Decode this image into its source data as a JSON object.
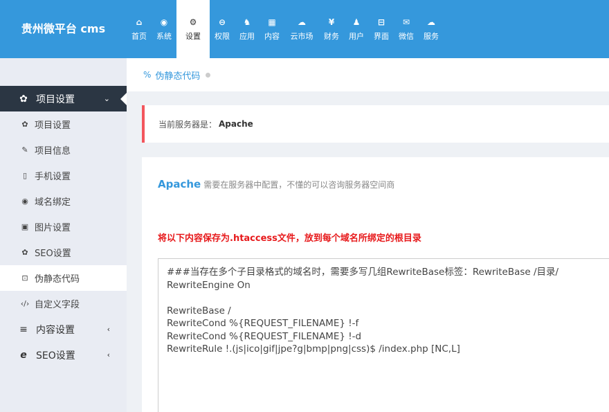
{
  "brand": "贵州微平台 cms",
  "nav": [
    {
      "label": "首页",
      "icon": "home-icon",
      "glyph": "⌂"
    },
    {
      "label": "系统",
      "icon": "globe-icon",
      "glyph": "◉"
    },
    {
      "label": "设置",
      "icon": "gears-icon",
      "glyph": "⚙",
      "active": true
    },
    {
      "label": "权限",
      "icon": "user-circle-icon",
      "glyph": "⊖"
    },
    {
      "label": "应用",
      "icon": "sitemap-icon",
      "glyph": "♞"
    },
    {
      "label": "内容",
      "icon": "grid-icon",
      "glyph": "▦"
    },
    {
      "label": "云市场",
      "icon": "cloud-icon",
      "glyph": "☁"
    },
    {
      "label": "财务",
      "icon": "yen-icon",
      "glyph": "¥"
    },
    {
      "label": "用户",
      "icon": "user-icon",
      "glyph": "♟"
    },
    {
      "label": "界面",
      "icon": "html5-icon",
      "glyph": "⊟"
    },
    {
      "label": "微信",
      "icon": "wechat-icon",
      "glyph": "✉"
    },
    {
      "label": "服务",
      "icon": "cloud-service-icon",
      "glyph": "☁"
    }
  ],
  "sidebar": {
    "group_open": {
      "label": "项目设置",
      "icon": "gear-icon",
      "glyph": "✿",
      "caret": "⌄"
    },
    "items": [
      {
        "label": "项目设置",
        "icon": "gear-icon",
        "glyph": "✿"
      },
      {
        "label": "项目信息",
        "icon": "edit-icon",
        "glyph": "✎"
      },
      {
        "label": "手机设置",
        "icon": "mobile-icon",
        "glyph": "▯"
      },
      {
        "label": "域名绑定",
        "icon": "globe-icon",
        "glyph": "◉"
      },
      {
        "label": "图片设置",
        "icon": "image-icon",
        "glyph": "▣"
      },
      {
        "label": "SEO设置",
        "icon": "gear-icon",
        "glyph": "✿"
      },
      {
        "label": "伪静态代码",
        "icon": "code-box-icon",
        "glyph": "⊡",
        "active": true
      },
      {
        "label": "自定义字段",
        "icon": "code-icon",
        "glyph": "‹/›"
      }
    ],
    "groups": [
      {
        "label": "内容设置",
        "icon": "bars-icon",
        "glyph": "≡",
        "caret": "‹"
      },
      {
        "label": "SEO设置",
        "icon": "ie-icon",
        "glyph": "e",
        "caret": "‹"
      }
    ]
  },
  "breadcrumb": {
    "label": "伪静态代码",
    "icon": "link-icon",
    "glyph": "%"
  },
  "notice": {
    "prefix": "当前服务器是：",
    "server": "Apache"
  },
  "panel": {
    "title": "Apache",
    "subtitle": "需要在服务器中配置，不懂的可以咨询服务器空间商",
    "warning": "将以下内容保存为.htaccess文件，放到每个域名所绑定的根目录",
    "code": "###当存在多个子目录格式的域名时，需要多写几组RewriteBase标签：RewriteBase /目录/\nRewriteEngine On\n\nRewriteBase /\nRewriteCond %{REQUEST_FILENAME} !-f\nRewriteCond %{REQUEST_FILENAME} !-d\nRewriteRule !.(js|ico|gif|jpe?g|bmp|png|css)$ /index.php [NC,L]"
  },
  "colors": {
    "accent": "#3598dc",
    "sidebar_dark": "#2b3643",
    "warning": "#e7191b",
    "notice_border": "#f3565d"
  }
}
